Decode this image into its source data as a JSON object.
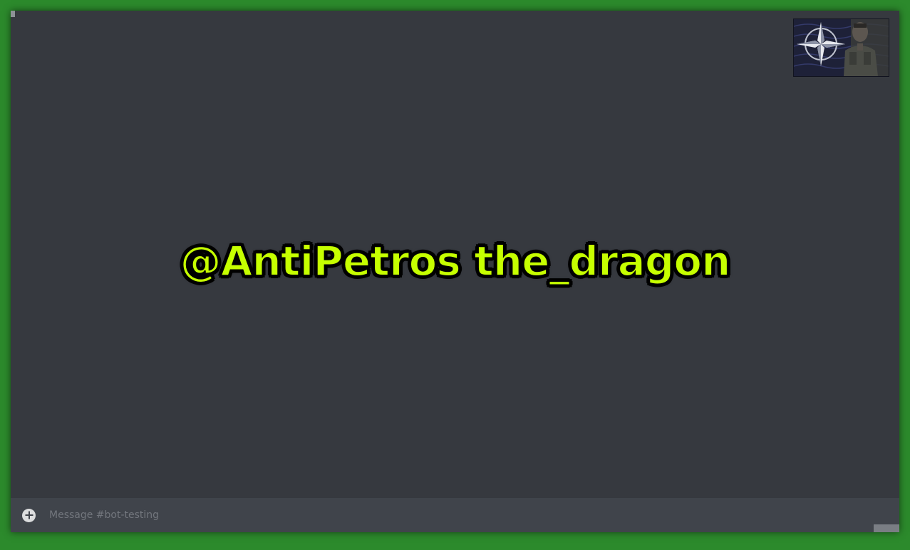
{
  "mention": {
    "text": "@AntiPetros the_dragon"
  },
  "composer": {
    "placeholder": "Message #bot-testing",
    "add_icon": "plus-circle-icon"
  },
  "avatar": {
    "icon": "compass-star-emblem-icon"
  },
  "colors": {
    "background": "#2c8a2c",
    "app": "#36393f",
    "composer": "#40444b",
    "mention": "#c6ff00"
  }
}
